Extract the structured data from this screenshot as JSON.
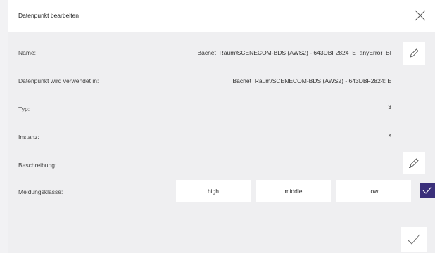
{
  "dialog": {
    "title": "Datenpunkt bearbeiten"
  },
  "fields": {
    "name": {
      "label": "Name:",
      "value": "Bacnet_Raum\\SCENECOM-BDS (AWS2) - 643DBF2824_E_anyError_BI"
    },
    "used_in": {
      "label": "Datenpunkt wird verwendet in:",
      "value": "Bacnet_Raum/SCENECOM-BDS (AWS2) - 643DBF2824: E"
    },
    "type": {
      "label": "Typ:",
      "value": "3"
    },
    "instance": {
      "label": "Instanz:",
      "value": "x"
    },
    "description": {
      "label": "Beschreibung:",
      "value": ""
    },
    "message_class": {
      "label": "Meldungsklasse:",
      "options": [
        "high",
        "middle",
        "low"
      ]
    }
  },
  "icons": {
    "close": "close-icon",
    "edit": "pencil-icon",
    "check": "checkmark-icon"
  },
  "colors": {
    "accent": "#3a2f7a",
    "header_bg": "#ffffff",
    "body_bg": "#efeff1"
  }
}
